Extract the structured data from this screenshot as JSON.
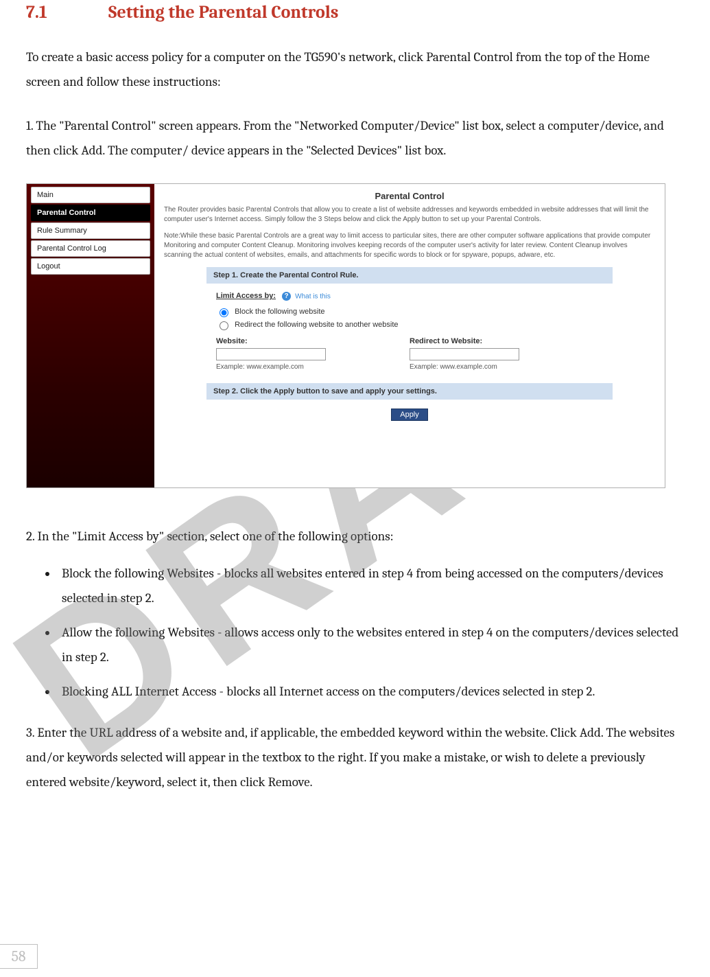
{
  "watermark": "DRAFT",
  "page_number": "58",
  "heading": {
    "number": "7.1",
    "title": "Setting the Parental Controls"
  },
  "intro": "To create a basic access policy for a computer on the TG590's network, click Parental Control from the top of the Home screen and follow these instructions:",
  "step1": "1.  The \"Parental Control\" screen appears. From the \"Networked Computer/Device\" list box, select a computer/device, and then click Add. The computer/ device appears in the \"Selected Devices\" list box.",
  "step2_lead": "2.  In the \"Limit Access by\" section, select one of the following options:",
  "bullets": [
    "Block the following Websites - blocks all websites entered in step 4 from being accessed on the computers/devices selected in step 2.",
    "Allow the following Websites - allows access only to the websites entered in step 4 on the computers/devices selected in step 2.",
    "Blocking ALL Internet Access - blocks all Internet access on the computers/devices selected in step 2."
  ],
  "step3": "3.  Enter the URL address of a website and, if applicable, the embedded keyword within the website. Click Add. The websites and/or keywords selected will appear in the textbox to the right. If you make a mistake, or wish to delete a previously entered website/keyword, select it, then click Remove.",
  "shot": {
    "sidebar": {
      "items": [
        {
          "label": "Main",
          "active": false
        },
        {
          "label": "Parental Control",
          "active": true
        },
        {
          "label": "Rule Summary",
          "active": false
        },
        {
          "label": "Parental Control Log",
          "active": false
        },
        {
          "label": "Logout",
          "active": false
        }
      ]
    },
    "title": "Parental Control",
    "intro1": "The Router provides basic Parental Controls that allow you to create a list of website addresses and keywords embedded in website addresses that will limit the computer user's Internet access. Simply follow the 3 Steps below and click the Apply button to set up your Parental Controls.",
    "intro2": "Note:While these basic Parental Controls are a great way to limit access to particular sites, there are other computer software applications that provide computer Monitoring and computer Content Cleanup. Monitoring involves keeping records of the computer user's activity for later review. Content Cleanup involves scanning the actual content of websites, emails, and attachments for specific words to block or for spyware, popups, adware, etc.",
    "step1_bar": "Step 1. Create the Parental Control Rule.",
    "limit_label": "Limit Access by:",
    "help_text": "What is this",
    "radio_block": "Block the following website",
    "radio_redirect": "Redirect the following website to another website",
    "website_label": "Website:",
    "redirect_label": "Redirect to Website:",
    "example": "Example: www.example.com",
    "step2_bar": "Step 2. Click the Apply button to save and apply your settings.",
    "apply": "Apply"
  }
}
